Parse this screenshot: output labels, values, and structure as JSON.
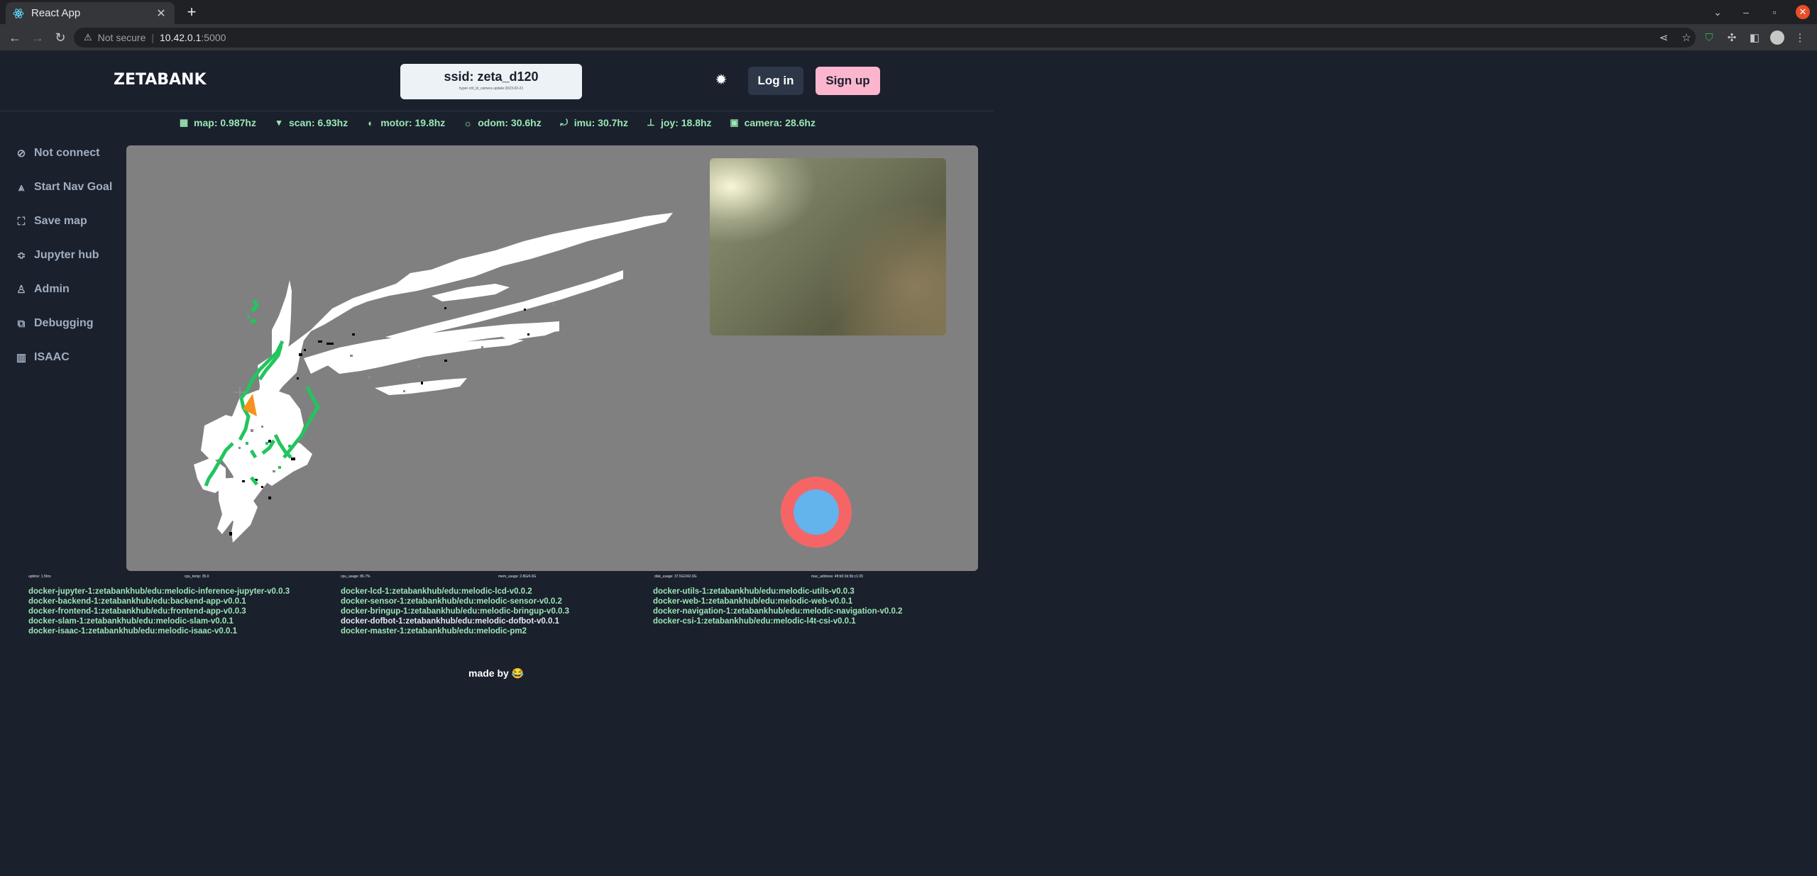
{
  "browser": {
    "tab_title": "React App",
    "tab_close": "✕",
    "new_tab": "+",
    "security_label": "Not secure",
    "url_host": "10.42.0.1",
    "url_port": ":5000"
  },
  "header": {
    "logo": "ZETABANK",
    "ssid": "ssid: zeta_d120",
    "ssid_sub": "hyper-ctrl_ld_camera update:2023-03-21",
    "login_label": "Log in",
    "signup_label": "Sign up"
  },
  "status": [
    {
      "icon": "grid-icon",
      "label": "map: 0.987hz"
    },
    {
      "icon": "wifi-icon",
      "label": "scan: 6.93hz"
    },
    {
      "icon": "motor-icon",
      "label": "motor: 19.8hz"
    },
    {
      "icon": "sun-icon",
      "label": "odom: 30.6hz"
    },
    {
      "icon": "imu-icon",
      "label": "imu: 30.7hz"
    },
    {
      "icon": "joystick-icon",
      "label": "joy: 18.8hz"
    },
    {
      "icon": "camera-icon",
      "label": "camera: 28.6hz"
    }
  ],
  "sidebar": {
    "items": [
      {
        "icon": "compass-icon",
        "label": "Not connect"
      },
      {
        "icon": "navigation-icon",
        "label": "Start Nav Goal"
      },
      {
        "icon": "map-icon",
        "label": "Save map"
      },
      {
        "icon": "jupyter-icon",
        "label": "Jupyter hub"
      },
      {
        "icon": "user-icon",
        "label": "Admin"
      },
      {
        "icon": "debug-icon",
        "label": "Debugging"
      },
      {
        "icon": "bar-chart-icon",
        "label": "ISAAC"
      }
    ]
  },
  "system_info": [
    "uptime: 1.5hrs",
    "cpu_temp: 35.0",
    "cpu_usage: 86.7%",
    "mem_usage: 2.8G/4.0G",
    "disk_usage: 37.5G/242.0G",
    "mac_address: 48:b0:2d:3b:c1:29"
  ],
  "containers": {
    "col1": [
      {
        "name": "docker-jupyter-1:zetabankhub/edu:melodic-inference-jupyter-v0.0.3",
        "running": true
      },
      {
        "name": "docker-backend-1:zetabankhub/edu:backend-app-v0.0.1",
        "running": true
      },
      {
        "name": "docker-frontend-1:zetabankhub/edu:frontend-app-v0.0.3",
        "running": true
      },
      {
        "name": "docker-slam-1:zetabankhub/edu:melodic-slam-v0.0.1",
        "running": true
      },
      {
        "name": "docker-isaac-1:zetabankhub/edu:melodic-isaac-v0.0.1",
        "running": true
      }
    ],
    "col2": [
      {
        "name": "docker-lcd-1:zetabankhub/edu:melodic-lcd-v0.0.2",
        "running": true
      },
      {
        "name": "docker-sensor-1:zetabankhub/edu:melodic-sensor-v0.0.2",
        "running": true
      },
      {
        "name": "docker-bringup-1:zetabankhub/edu:melodic-bringup-v0.0.3",
        "running": true
      },
      {
        "name": "docker-dofbot-1:zetabankhub/edu:melodic-dofbot-v0.0.1",
        "running": false
      },
      {
        "name": "docker-master-1:zetabankhub/edu:melodic-pm2",
        "running": true
      }
    ],
    "col3": [
      {
        "name": "docker-utils-1:zetabankhub/edu:melodic-utils-v0.0.3",
        "running": true
      },
      {
        "name": "docker-web-1:zetabankhub/edu:melodic-web-v0.0.1",
        "running": true
      },
      {
        "name": "docker-navigation-1:zetabankhub/edu:melodic-navigation-v0.0.2",
        "running": true
      },
      {
        "name": "docker-csi-1:zetabankhub/edu:melodic-l4t-csi-v0.0.1",
        "running": true
      }
    ]
  },
  "footer": "made by 😂",
  "colors": {
    "background": "#1a202c",
    "accent_green": "#9ae6b4",
    "signup_pink": "#fbb6ce",
    "map_unknown": "#808080",
    "joystick_ring": "#f56565",
    "joystick_knob": "#63b3ed",
    "robot_marker": "#f6921e",
    "scan_green": "#22c55e"
  }
}
